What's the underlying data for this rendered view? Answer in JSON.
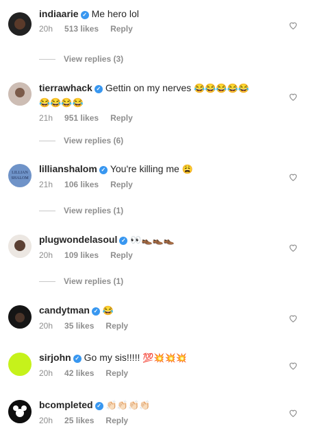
{
  "comments": [
    {
      "user": "indiaarie",
      "text": "Me hero lol",
      "emoji": "",
      "time": "20h",
      "likes": "513 likes",
      "reply": "Reply",
      "replies": "View replies (3)"
    },
    {
      "user": "tierrawhack",
      "text": "Gettin on my nerves",
      "emoji": "😂😂😂😂😂",
      "emoji2": "😂😂😂😂",
      "time": "21h",
      "likes": "951 likes",
      "reply": "Reply",
      "replies": "View replies (6)"
    },
    {
      "user": "lillianshalom",
      "text": "You're killing me",
      "emoji": "😩",
      "time": "21h",
      "likes": "106 likes",
      "reply": "Reply",
      "replies": "View replies (1)"
    },
    {
      "user": "plugwondelasoul",
      "text": "",
      "emoji": "👀👞👞👞",
      "time": "20h",
      "likes": "109 likes",
      "reply": "Reply",
      "replies": "View replies (1)"
    },
    {
      "user": "candytman",
      "text": "",
      "emoji": "😂",
      "time": "20h",
      "likes": "35 likes",
      "reply": "Reply"
    },
    {
      "user": "sirjohn",
      "text": "Go my sis!!!!!",
      "emoji": "💯💥💥💥",
      "time": "20h",
      "likes": "42 likes",
      "reply": "Reply"
    },
    {
      "user": "bcompleted",
      "text": "",
      "emoji": "👏🏻👏🏻👏🏻👏🏻",
      "time": "20h",
      "likes": "25 likes",
      "reply": "Reply"
    }
  ],
  "avatar_text": {
    "lillianshalom": "LILLIAN SHALOM"
  },
  "colors": {
    "verified": "#3897f0",
    "meta": "#8e8e8e",
    "sirjohn_avatar": "#c6f21b"
  }
}
